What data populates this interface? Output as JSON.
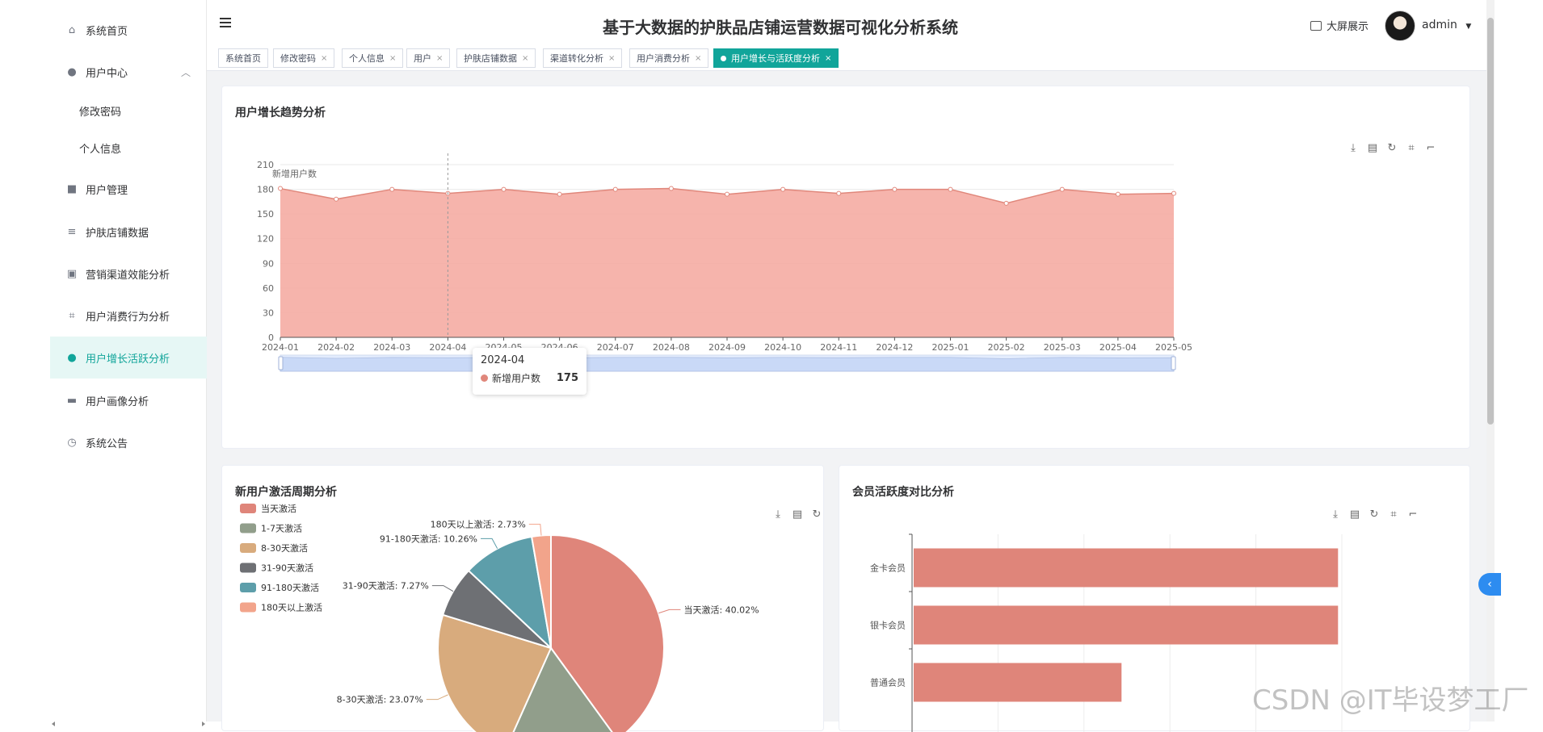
{
  "app": {
    "title": "基于大数据的护肤品店铺运营数据可视化分析系统",
    "bigscreen_label": "大屏展示",
    "user_name": "admin"
  },
  "sidebar": {
    "items": [
      {
        "label": "系统首页",
        "icon": "home-icon"
      },
      {
        "label": "用户中心",
        "icon": "user-icon"
      },
      {
        "label": "修改密码",
        "icon": ""
      },
      {
        "label": "个人信息",
        "icon": ""
      },
      {
        "label": "用户管理",
        "icon": "folder-icon"
      },
      {
        "label": "护肤店铺数据",
        "icon": "list-icon"
      },
      {
        "label": "营销渠道效能分析",
        "icon": "chart-icon"
      },
      {
        "label": "用户消费行为分析",
        "icon": "crop-icon"
      },
      {
        "label": "用户增长活跃分析",
        "icon": "user-icon"
      },
      {
        "label": "用户画像分析",
        "icon": "message-icon"
      },
      {
        "label": "系统公告",
        "icon": "clock-icon"
      }
    ]
  },
  "tabs": [
    {
      "label": "系统首页"
    },
    {
      "label": "修改密码"
    },
    {
      "label": "个人信息"
    },
    {
      "label": "用户"
    },
    {
      "label": "护肤店铺数据"
    },
    {
      "label": "渠道转化分析"
    },
    {
      "label": "用户消费分析"
    },
    {
      "label": "用户增长与活跃度分析"
    }
  ],
  "watermark": "CSDN @IT毕设梦工厂",
  "colors": {
    "accent": "#11a59a",
    "area": "#f4a79d",
    "line": "#e0877b",
    "bar": "#df857a"
  },
  "chart_data": [
    {
      "type": "area",
      "title": "用户增长趋势分析",
      "ylabel": "新增用户数",
      "x": [
        "2024-01",
        "2024-02",
        "2024-03",
        "2024-04",
        "2024-05",
        "2024-06",
        "2024-07",
        "2024-08",
        "2024-09",
        "2024-10",
        "2024-11",
        "2024-12",
        "2025-01",
        "2025-02",
        "2025-03",
        "2025-04",
        "2025-05"
      ],
      "series": [
        {
          "name": "新增用户数",
          "values": [
            181,
            168,
            180,
            175,
            180,
            174,
            180,
            181,
            174,
            180,
            175,
            180,
            180,
            163,
            180,
            174,
            175
          ]
        }
      ],
      "ylim": [
        0,
        210
      ],
      "yticks": [
        0,
        30,
        60,
        90,
        120,
        150,
        180,
        210
      ],
      "tooltip": {
        "x": "2024-04",
        "series": "新增用户数",
        "value": "175"
      },
      "grid": true
    },
    {
      "type": "pie",
      "title": "新用户激活周期分析",
      "legend_position": "top-left",
      "slices": [
        {
          "name": "当天激活",
          "value": 40.02,
          "label": "当天激活: 40.02%",
          "color": "#df857a"
        },
        {
          "name": "1-7天激活",
          "value": 16.69,
          "label": "",
          "color": "#919e8b"
        },
        {
          "name": "8-30天激活",
          "value": 23.07,
          "label": "8-30天激活: 23.07%",
          "color": "#d8ab7d"
        },
        {
          "name": "31-90天激活",
          "value": 7.27,
          "label": "31-90天激活: 7.27%",
          "color": "#6e7074"
        },
        {
          "name": "91-180天激活",
          "value": 10.26,
          "label": "91-180天激活: 10.26%",
          "color": "#5d9eaa"
        },
        {
          "name": "180天以上激活",
          "value": 2.73,
          "label": "180天以上激活: 2.73%",
          "color": "#f2a48b"
        }
      ]
    },
    {
      "type": "bar",
      "orientation": "horizontal",
      "title": "会员活跃度对比分析",
      "categories": [
        "金卡会员",
        "银卡会员",
        "普通会员"
      ],
      "values": [
        0.98,
        0.98,
        0.48
      ],
      "value_scale": "fraction of visible axis width"
    }
  ]
}
